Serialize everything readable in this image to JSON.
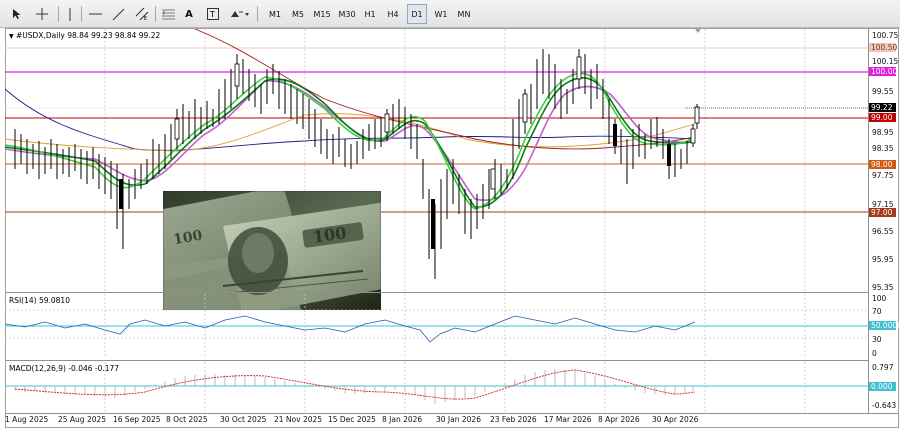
{
  "toolbar": {
    "tools": [
      "cursor",
      "crosshair",
      "vertical-line",
      "horizontal-line",
      "trend-line",
      "channel",
      "text",
      "text-label",
      "more-shapes"
    ],
    "text_tool_label": "A",
    "timeframes": [
      "M1",
      "M5",
      "M15",
      "M30",
      "H1",
      "H4",
      "D1",
      "W1",
      "MN"
    ],
    "active_timeframe": "D1"
  },
  "chart": {
    "symbol_info": "#USDX,Daily  98.84 99.23 98.84 99.22",
    "price_ticks": [
      "100.75",
      "100.15",
      "99.55",
      "98.95",
      "98.35",
      "97.75",
      "97.15",
      "96.55",
      "95.95",
      "95.35"
    ],
    "level_tags": [
      {
        "text": "100.50",
        "color": "#f0c7b8"
      },
      {
        "text": "100.00",
        "color": "#e020e0"
      },
      {
        "text": "99.22",
        "color": "#000000"
      },
      {
        "text": "99.00",
        "color": "#c00000"
      },
      {
        "text": "98.00",
        "color": "#d05a10"
      },
      {
        "text": "97.00",
        "color": "#a03c1c"
      }
    ],
    "dates": [
      "1 Aug 2025",
      "25 Aug 2025",
      "16 Sep 2025",
      "8 Oct 2025",
      "30 Oct 2025",
      "21 Nov 2025",
      "15 Dec 2025",
      "8 Jan 2026",
      "30 Jan 2026",
      "23 Feb 2026",
      "17 Mar 2026",
      "8 Apr 2026",
      "30 Apr 2026"
    ]
  },
  "rsi": {
    "label": "RSI(14) 59.0810",
    "ticks": [
      "100",
      "70",
      "30",
      "0"
    ],
    "level_tag": "50.0000"
  },
  "macd": {
    "label": "MACD(12,26,9) -0.046 -0.177",
    "top_tick": "0.797",
    "zero_tag": "0.000",
    "bottom_tick": "-0.643"
  }
}
